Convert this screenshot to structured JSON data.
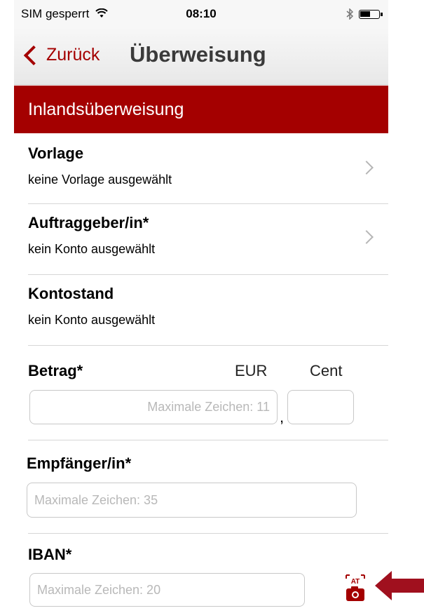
{
  "status_bar": {
    "carrier": "SIM gesperrt",
    "time": "08:10"
  },
  "nav": {
    "back_label": "Zurück",
    "title": "Überweisung"
  },
  "section_header": "Inlandsüberweisung",
  "rows": [
    {
      "title": "Vorlage",
      "subtitle": "keine Vorlage ausgewählt",
      "disclosure": true
    },
    {
      "title": "Auftraggeber/in*",
      "subtitle": "kein Konto ausgewählt",
      "disclosure": true
    },
    {
      "title": "Kontostand",
      "subtitle": "kein Konto ausgewählt",
      "disclosure": false
    }
  ],
  "amount": {
    "label": "Betrag*",
    "eur_label": "EUR",
    "cent_label": "Cent",
    "eur_placeholder": "Maximale Zeichen: 11",
    "cent_value": "",
    "separator": ","
  },
  "recipient": {
    "label": "Empfänger/in*",
    "placeholder": "Maximale Zeichen: 35"
  },
  "iban": {
    "label": "IBAN*",
    "placeholder": "Maximale Zeichen: 20",
    "scan_icon_text": "AT"
  },
  "colors": {
    "brand": "#a40000",
    "arrow": "#a0101e"
  }
}
